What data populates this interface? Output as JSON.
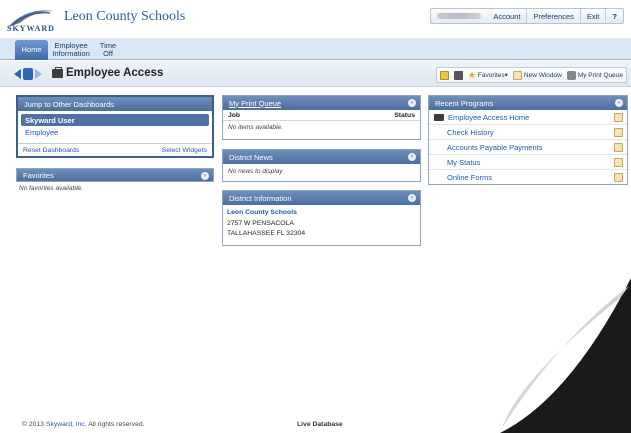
{
  "header": {
    "logo_word": "SKYWARD",
    "school_name": "Leon County Schools",
    "user_nav": [
      "Account",
      "Preferences",
      "Exit"
    ],
    "help": "?"
  },
  "tabs": [
    {
      "label": "Home",
      "active": true
    },
    {
      "label": "Employee Information"
    },
    {
      "label": "Time Off"
    }
  ],
  "title": "Employee Access",
  "toolbar": {
    "favorites": "Favorites▾",
    "new_window": "New Window",
    "my_print_queue": "My Print Queue"
  },
  "jump": {
    "title": "Jump to Other Dashboards",
    "items": [
      "Skyward User",
      "Employee"
    ],
    "reset": "Reset Dashboards",
    "select": "Select Widgets"
  },
  "favorites": {
    "title": "Favorites",
    "empty": "No favorites available."
  },
  "print_queue": {
    "title": "My Print Queue",
    "col_job": "Job",
    "col_status": "Status",
    "empty": "No items available."
  },
  "district_news": {
    "title": "District News",
    "empty": "No news to display"
  },
  "district_info": {
    "title": "District Information",
    "name": "Leon County Schools",
    "address1": "2757 W PENSACOLA",
    "address2": "TALLAHASSEE FL 32304"
  },
  "recent": {
    "title": "Recent Programs",
    "items": [
      "Employee Access Home",
      "Check History",
      "Accounts Payable Payments",
      "My Status",
      "Online Forms"
    ]
  },
  "footer": {
    "copyright_pre": "© 2013",
    "company": "Skyward, Inc.",
    "copyright_post": "All rights reserved.",
    "database": "Live Database"
  },
  "colors": {
    "panel_header": "#4c6e9e",
    "link": "#1e58b3",
    "tab_active": "#3c6aaa"
  }
}
